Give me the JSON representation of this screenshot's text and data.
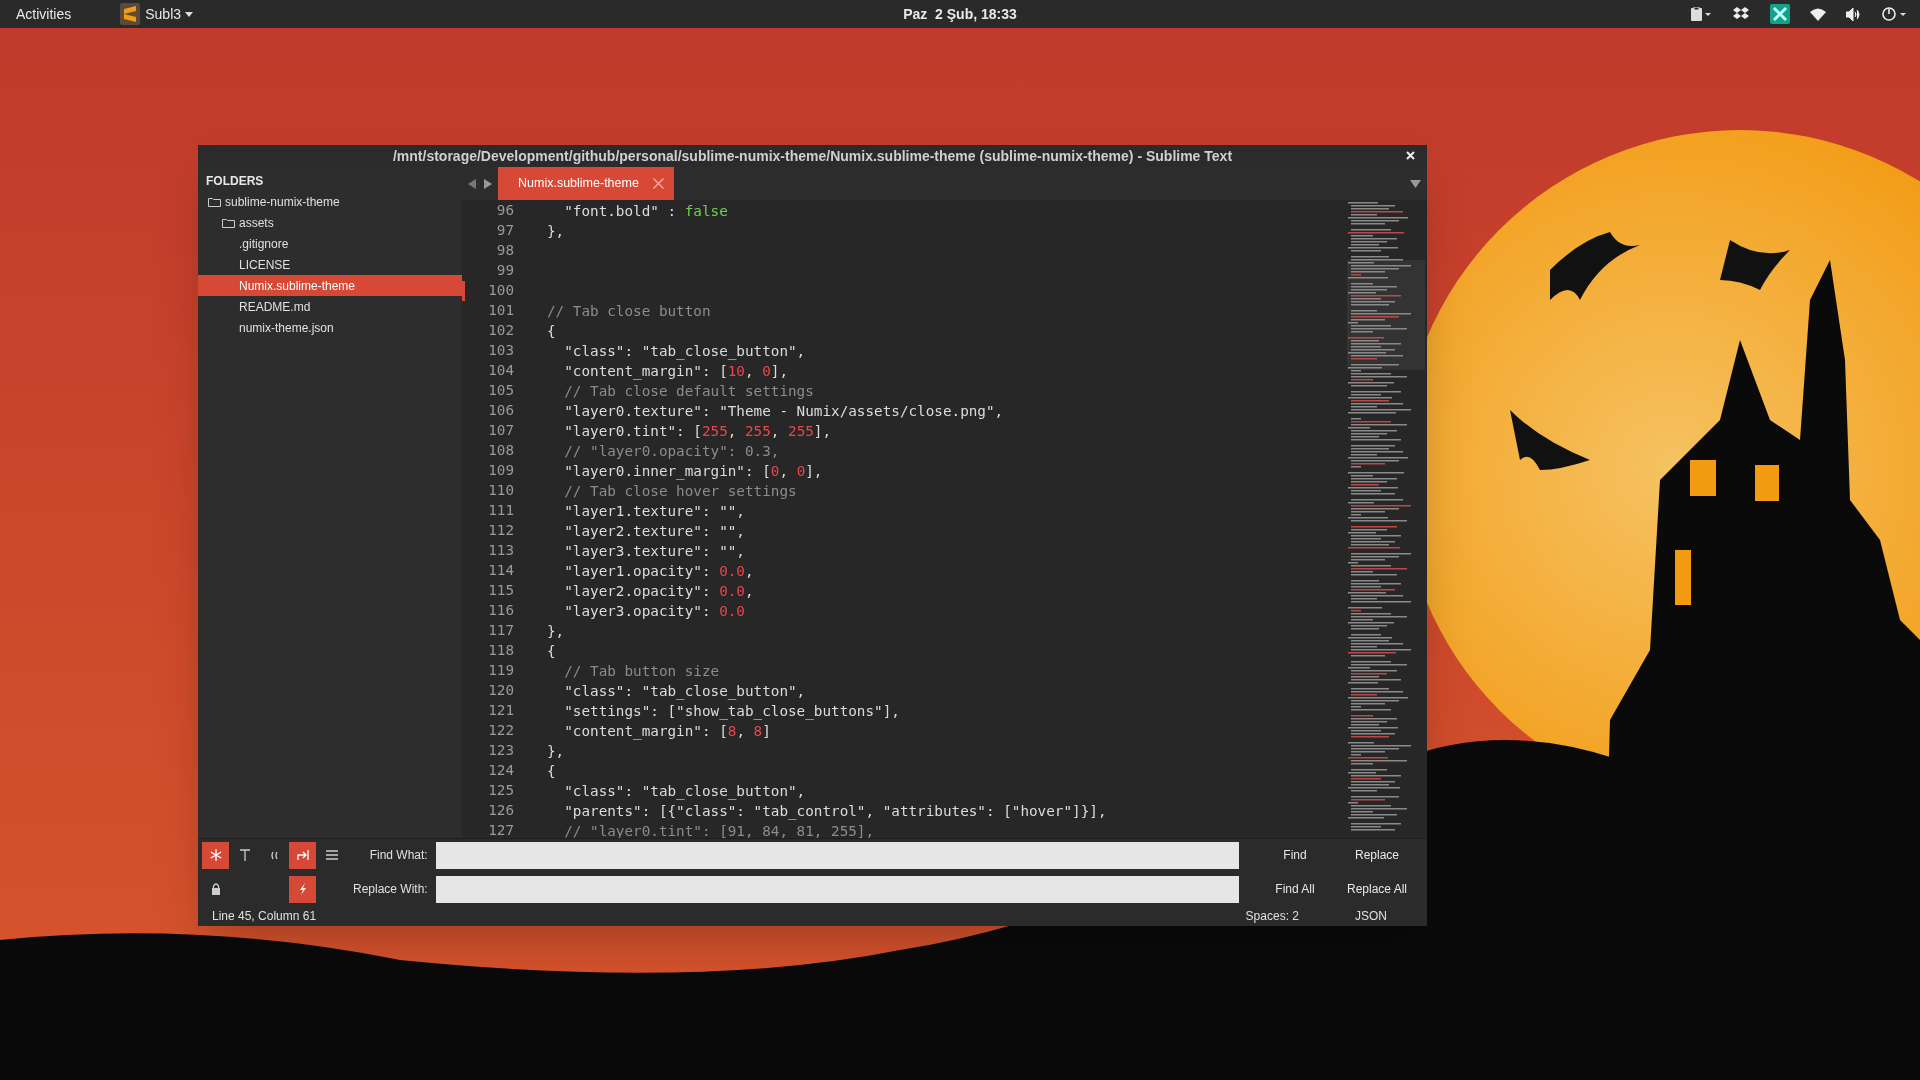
{
  "top_bar": {
    "activities": "Activities",
    "app_name": "Subl3",
    "clock": "Paz  2 Şub, 18:33"
  },
  "window": {
    "title": "/mnt/storage/Development/github/personal/sublime-numix-theme/Numix.sublime-theme (sublime-numix-theme) - Sublime Text"
  },
  "sidebar": {
    "heading": "FOLDERS",
    "items": [
      {
        "label": "sublime-numix-theme",
        "kind": "folder",
        "selected": false,
        "children": [
          {
            "label": "assets",
            "kind": "folder",
            "selected": false
          },
          {
            "label": ".gitignore",
            "kind": "file",
            "selected": false
          },
          {
            "label": "LICENSE",
            "kind": "file",
            "selected": false
          },
          {
            "label": "Numix.sublime-theme",
            "kind": "file",
            "selected": true
          },
          {
            "label": "README.md",
            "kind": "file",
            "selected": false
          },
          {
            "label": "numix-theme.json",
            "kind": "file",
            "selected": false
          }
        ]
      }
    ]
  },
  "tabs": [
    {
      "label": "Numix.sublime-theme",
      "selected": true
    }
  ],
  "editor": {
    "lines": [
      {
        "number": "96",
        "modified": false,
        "segments": [
          {
            "kind": "text",
            "text": "  \"font.bold\" : "
          },
          {
            "kind": "constant",
            "text": "false"
          }
        ]
      },
      {
        "number": "97",
        "modified": false,
        "segments": [
          {
            "kind": "text",
            "text": "},"
          }
        ]
      },
      {
        "number": "98",
        "modified": false
      },
      {
        "number": "99",
        "modified": false
      },
      {
        "number": "100",
        "modified": true
      },
      {
        "number": "101",
        "modified": false,
        "segments": [
          {
            "kind": "comment",
            "text": "// Tab close button"
          }
        ]
      },
      {
        "number": "102",
        "modified": false,
        "segments": [
          {
            "kind": "text",
            "text": "{"
          }
        ]
      },
      {
        "number": "103",
        "modified": false,
        "segments": [
          {
            "kind": "text",
            "text": "  \"class\": \"tab_close_button\","
          }
        ]
      },
      {
        "number": "104",
        "modified": false,
        "segments": [
          {
            "kind": "text",
            "text": "  \"content_margin\": ["
          },
          {
            "kind": "number",
            "text": "10"
          },
          {
            "kind": "text",
            "text": ", "
          },
          {
            "kind": "number",
            "text": "0"
          },
          {
            "kind": "text",
            "text": "],"
          }
        ]
      },
      {
        "number": "105",
        "modified": false,
        "segments": [
          {
            "kind": "comment",
            "text": "  // Tab close default settings"
          }
        ]
      },
      {
        "number": "106",
        "modified": false,
        "segments": [
          {
            "kind": "text",
            "text": "  \"layer0.texture\": \"Theme - Numix/assets/close.png\","
          }
        ]
      },
      {
        "number": "107",
        "modified": false,
        "segments": [
          {
            "kind": "text",
            "text": "  \"layer0.tint\": ["
          },
          {
            "kind": "number",
            "text": "255"
          },
          {
            "kind": "text",
            "text": ", "
          },
          {
            "kind": "number",
            "text": "255"
          },
          {
            "kind": "text",
            "text": ", "
          },
          {
            "kind": "number",
            "text": "255"
          },
          {
            "kind": "text",
            "text": "],"
          }
        ]
      },
      {
        "number": "108",
        "modified": false,
        "segments": [
          {
            "kind": "comment",
            "text": "  // \"layer0.opacity\": 0.3,"
          }
        ]
      },
      {
        "number": "109",
        "modified": false,
        "segments": [
          {
            "kind": "text",
            "text": "  \"layer0.inner_margin\": ["
          },
          {
            "kind": "number",
            "text": "0"
          },
          {
            "kind": "text",
            "text": ", "
          },
          {
            "kind": "number",
            "text": "0"
          },
          {
            "kind": "text",
            "text": "],"
          }
        ]
      },
      {
        "number": "110",
        "modified": false,
        "segments": [
          {
            "kind": "comment",
            "text": "  // Tab close hover settings"
          }
        ]
      },
      {
        "number": "111",
        "modified": false,
        "segments": [
          {
            "kind": "text",
            "text": "  \"layer1.texture\": \"\","
          }
        ]
      },
      {
        "number": "112",
        "modified": false,
        "segments": [
          {
            "kind": "text",
            "text": "  \"layer2.texture\": \"\","
          }
        ]
      },
      {
        "number": "113",
        "modified": false,
        "segments": [
          {
            "kind": "text",
            "text": "  \"layer3.texture\": \"\","
          }
        ]
      },
      {
        "number": "114",
        "modified": false,
        "segments": [
          {
            "kind": "text",
            "text": "  \"layer1.opacity\": "
          },
          {
            "kind": "number",
            "text": "0.0"
          },
          {
            "kind": "text",
            "text": ","
          }
        ]
      },
      {
        "number": "115",
        "modified": false,
        "segments": [
          {
            "kind": "text",
            "text": "  \"layer2.opacity\": "
          },
          {
            "kind": "number",
            "text": "0.0"
          },
          {
            "kind": "text",
            "text": ","
          }
        ]
      },
      {
        "number": "116",
        "modified": false,
        "segments": [
          {
            "kind": "text",
            "text": "  \"layer3.opacity\": "
          },
          {
            "kind": "number",
            "text": "0.0"
          }
        ]
      },
      {
        "number": "117",
        "modified": false,
        "segments": [
          {
            "kind": "text",
            "text": "},"
          }
        ]
      },
      {
        "number": "118",
        "modified": false,
        "segments": [
          {
            "kind": "text",
            "text": "{"
          }
        ]
      },
      {
        "number": "119",
        "modified": false,
        "segments": [
          {
            "kind": "comment",
            "text": "  // Tab button size"
          }
        ]
      },
      {
        "number": "120",
        "modified": false,
        "segments": [
          {
            "kind": "text",
            "text": "  \"class\": \"tab_close_button\","
          }
        ]
      },
      {
        "number": "121",
        "modified": false,
        "segments": [
          {
            "kind": "text",
            "text": "  \"settings\": [\"show_tab_close_buttons\"],"
          }
        ]
      },
      {
        "number": "122",
        "modified": false,
        "segments": [
          {
            "kind": "text",
            "text": "  \"content_margin\": ["
          },
          {
            "kind": "number",
            "text": "8"
          },
          {
            "kind": "text",
            "text": ", "
          },
          {
            "kind": "number",
            "text": "8"
          },
          {
            "kind": "text",
            "text": "]"
          }
        ]
      },
      {
        "number": "123",
        "modified": false,
        "segments": [
          {
            "kind": "text",
            "text": "},"
          }
        ]
      },
      {
        "number": "124",
        "modified": false,
        "segments": [
          {
            "kind": "text",
            "text": "{"
          }
        ]
      },
      {
        "number": "125",
        "modified": false,
        "segments": [
          {
            "kind": "text",
            "text": "  \"class\": \"tab_close_button\","
          }
        ]
      },
      {
        "number": "126",
        "modified": false,
        "segments": [
          {
            "kind": "text",
            "text": "  \"parents\": [{\"class\": \"tab_control\", \"attributes\": [\"hover\"]}],"
          }
        ]
      },
      {
        "number": "127",
        "modified": false,
        "segments": [
          {
            "kind": "comment",
            "text": "  // \"layer0.tint\": [91, 84, 81, 255],"
          }
        ]
      }
    ]
  },
  "find_panel": {
    "toggles": [
      [
        {
          "kind": "regex",
          "selected": true
        },
        {
          "kind": "case",
          "selected": false
        },
        {
          "kind": "word",
          "selected": false
        },
        {
          "kind": "wrap",
          "selected": true
        },
        {
          "kind": "selection",
          "selected": false
        }
      ],
      [
        {
          "kind": "lock",
          "selected": false
        },
        {
          "kind": "none"
        },
        {
          "kind": "none"
        },
        {
          "kind": "preserve",
          "selected": true
        }
      ]
    ],
    "find_label": "Find What:",
    "replace_label": "Replace With:",
    "buttons": [
      [
        "Find",
        "Replace"
      ],
      [
        "Find All",
        "Replace All"
      ]
    ]
  },
  "status_bar": {
    "position": "Line 45, Column 61",
    "indentation": "Spaces: 2",
    "syntax": "JSON"
  }
}
